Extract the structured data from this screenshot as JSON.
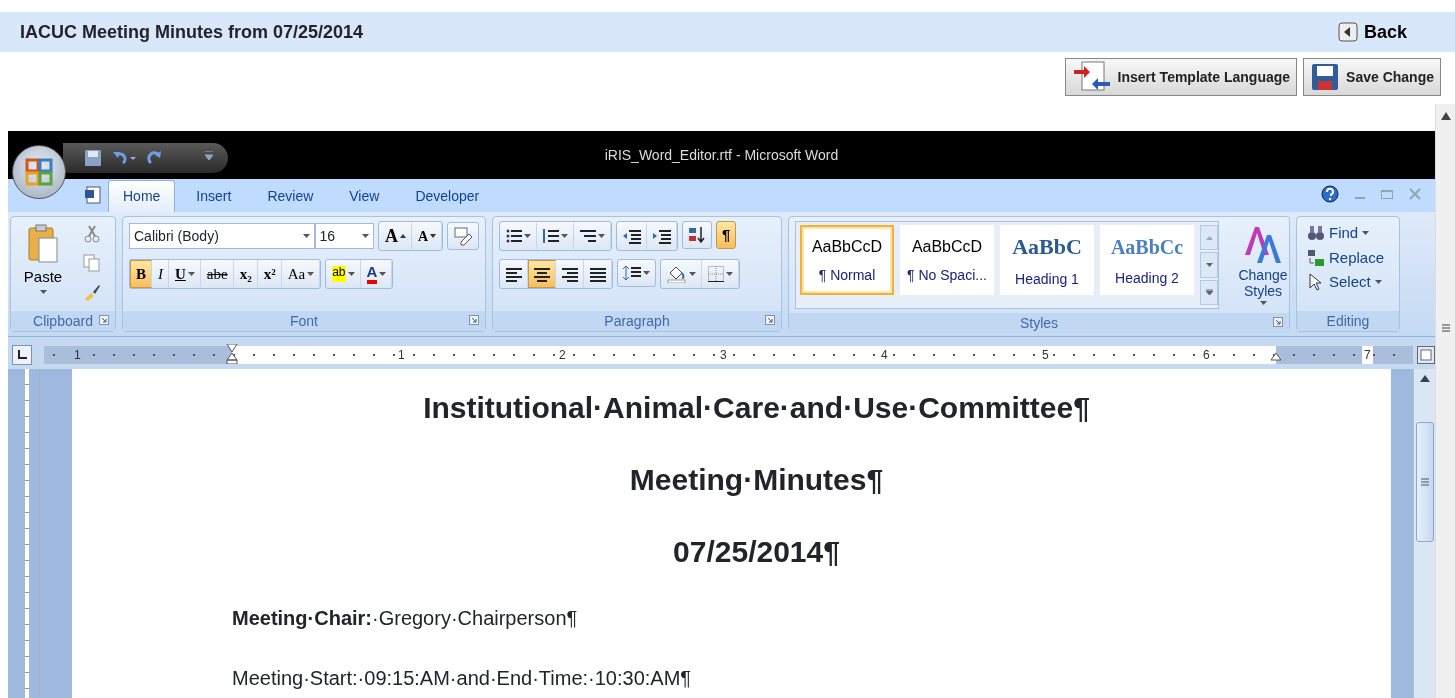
{
  "page": {
    "title": "IACUC Meeting Minutes from 07/25/2014",
    "back": "Back"
  },
  "actions": [
    {
      "kind": "template",
      "label": "Insert Template Language"
    },
    {
      "kind": "save",
      "label": "Save Change"
    }
  ],
  "word": {
    "title": "iRIS_Word_Editor.rtf  -  Microsoft Word",
    "tabs": [
      {
        "label": "Home",
        "selected": true
      },
      {
        "label": "Insert",
        "selected": false
      },
      {
        "label": "Review",
        "selected": false
      },
      {
        "label": "View",
        "selected": false
      },
      {
        "label": "Developer",
        "selected": false
      }
    ],
    "clipboard": {
      "label": "Clipboard",
      "paste": "Paste"
    },
    "font": {
      "label": "Font",
      "name": "Calibri (Body)",
      "size": "16",
      "grow": "A",
      "shrink": "A",
      "buttons": [
        {
          "kind": "bold",
          "glyph": "B",
          "selected": true
        },
        {
          "kind": "italic",
          "glyph": "I",
          "selected": false
        },
        {
          "kind": "underline",
          "glyph": "U",
          "selected": false
        },
        {
          "kind": "strike",
          "glyph": "abe",
          "selected": false
        },
        {
          "kind": "sub",
          "glyph": "x₂",
          "selected": false
        },
        {
          "kind": "sup",
          "glyph": "x²",
          "selected": false
        },
        {
          "kind": "case",
          "glyph": "Aa",
          "selected": false
        }
      ],
      "highlight": "ab",
      "color_glyph": "A"
    },
    "paragraph": {
      "label": "Paragraph",
      "align": [
        {
          "kind": "left",
          "selected": false
        },
        {
          "kind": "center",
          "selected": true
        },
        {
          "kind": "right",
          "selected": false
        },
        {
          "kind": "justify",
          "selected": false
        }
      ],
      "marks": {
        "glyph": "¶",
        "selected": true
      }
    },
    "styles": {
      "label": "Styles",
      "change": "Change Styles",
      "items": [
        {
          "kind": "body",
          "sample": "AaBbCcD",
          "name": "¶ Normal",
          "selected": true
        },
        {
          "kind": "body",
          "sample": "AaBbCcD",
          "name": "¶ No Spaci...",
          "selected": false
        },
        {
          "kind": "heading1",
          "sample": "AaBbC",
          "name": "Heading 1",
          "selected": false
        },
        {
          "kind": "heading2",
          "sample": "AaBbCc",
          "name": "Heading 2",
          "selected": false
        }
      ]
    },
    "editing": {
      "label": "Editing",
      "find": "Find",
      "replace": "Replace",
      "select": "Select"
    },
    "ruler": [
      "1",
      "1",
      "2",
      "3",
      "4",
      "5",
      "6",
      "7"
    ],
    "document": [
      {
        "kind": "heading",
        "text": "Institutional·Animal·Care·and·Use·Committee¶"
      },
      {
        "kind": "heading",
        "text": "Meeting·Minutes¶"
      },
      {
        "kind": "heading",
        "text": "07/25/2014¶"
      },
      {
        "kind": "body",
        "text": "**Meeting·Chair:**·Gregory·Chairperson¶"
      },
      {
        "kind": "body",
        "text": "Meeting·Start:·09:15:AM·and·End·Time:·10:30:AM¶"
      }
    ]
  }
}
